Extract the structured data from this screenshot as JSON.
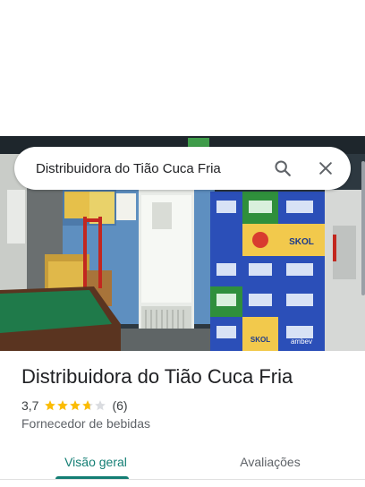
{
  "search": {
    "query": "Distribuidora do Tião Cuca Fria"
  },
  "place": {
    "title": "Distribuidora do Tião Cuca Fria",
    "rating": "3,7",
    "rating_value": 3.7,
    "rating_max": 5,
    "review_count": "(6)",
    "category": "Fornecedor de bebidas"
  },
  "photo": {
    "crate_labels": [
      "SKOL",
      "SKOL",
      "ambev"
    ]
  },
  "tabs": [
    {
      "label": "Visão geral",
      "selected": true
    },
    {
      "label": "Avaliações",
      "selected": false
    }
  ],
  "colors": {
    "accent": "#137e74",
    "star": "#fbbc04",
    "star_empty": "#dadce0"
  }
}
